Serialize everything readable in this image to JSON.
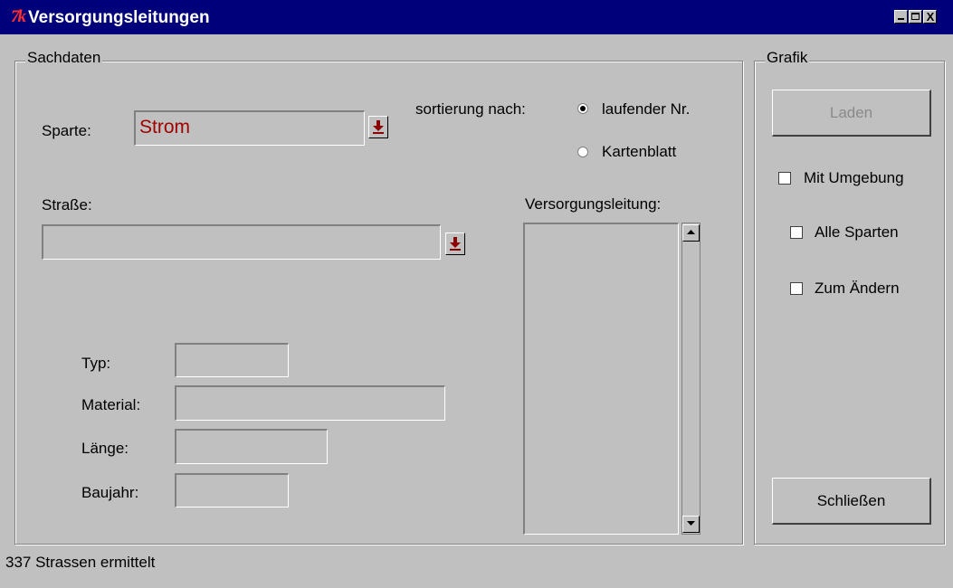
{
  "window": {
    "title": "Versorgungsleitungen",
    "logo_text": "7k",
    "controls": {
      "close_symbol": "X"
    }
  },
  "sachdaten": {
    "legend": "Sachdaten",
    "sparte_label": "Sparte:",
    "sparte_value": "Strom",
    "sort_label": "sortierung nach:",
    "sort_options": [
      {
        "label": "laufender Nr.",
        "selected": true
      },
      {
        "label": "Kartenblatt",
        "selected": false
      }
    ],
    "strasse_label": "Straße:",
    "strasse_value": "",
    "leitung_label": "Versorgungsleitung:",
    "fields": [
      {
        "label": "Typ:",
        "value": ""
      },
      {
        "label": "Material:",
        "value": ""
      },
      {
        "label": "Länge:",
        "value": ""
      },
      {
        "label": "Baujahr:",
        "value": ""
      }
    ]
  },
  "grafik": {
    "legend": "Grafik",
    "load_button": "Laden",
    "options": [
      {
        "label": "Mit Umgebung",
        "checked": false
      },
      {
        "label": "Alle Sparten",
        "checked": false
      },
      {
        "label": "Zum Ändern",
        "checked": false
      }
    ],
    "close_button": "Schließen"
  },
  "status": {
    "text": "337 Strassen ermittelt"
  },
  "colors": {
    "titlebar": "#00007a",
    "window_bg": "#c0c0c0",
    "entry_text": "#a00000",
    "dropdown_arrow": "#8b0000"
  },
  "icons": {
    "dropdown": "arrow-down-to-bar-icon",
    "scroll_up": "triangle-up-icon",
    "scroll_down": "triangle-down-icon"
  }
}
